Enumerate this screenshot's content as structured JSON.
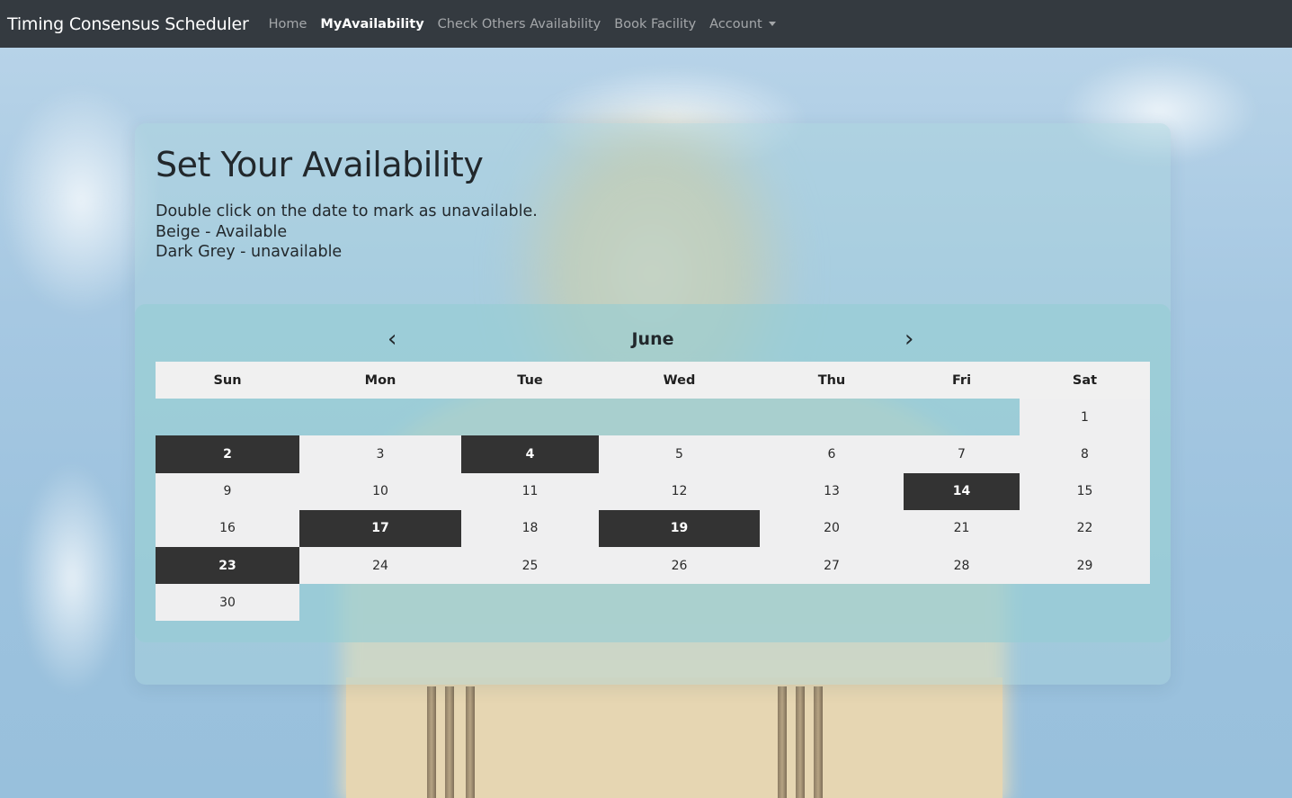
{
  "navbar": {
    "brand": "Timing Consensus Scheduler",
    "links": [
      {
        "label": "Home",
        "active": false
      },
      {
        "label": "MyAvailability",
        "active": true
      },
      {
        "label": "Check Others Availability",
        "active": false
      },
      {
        "label": "Book Facility",
        "active": false
      },
      {
        "label": "Account",
        "active": false,
        "dropdown": true
      }
    ]
  },
  "page": {
    "title": "Set Your Availability",
    "instructions": [
      "Double click on the date to mark as unavailable.",
      "Beige - Available",
      "Dark Grey - unavailable"
    ]
  },
  "calendar": {
    "month": "June",
    "prev_icon": "‹",
    "next_icon": "›",
    "weekdays": [
      "Sun",
      "Mon",
      "Tue",
      "Wed",
      "Thu",
      "Fri",
      "Sat"
    ],
    "first_weekday_index": 6,
    "days_in_month": 30,
    "unavailable_days": [
      2,
      4,
      14,
      17,
      19,
      23
    ],
    "colors": {
      "available": "#efeff0",
      "unavailable": "#333333"
    }
  }
}
